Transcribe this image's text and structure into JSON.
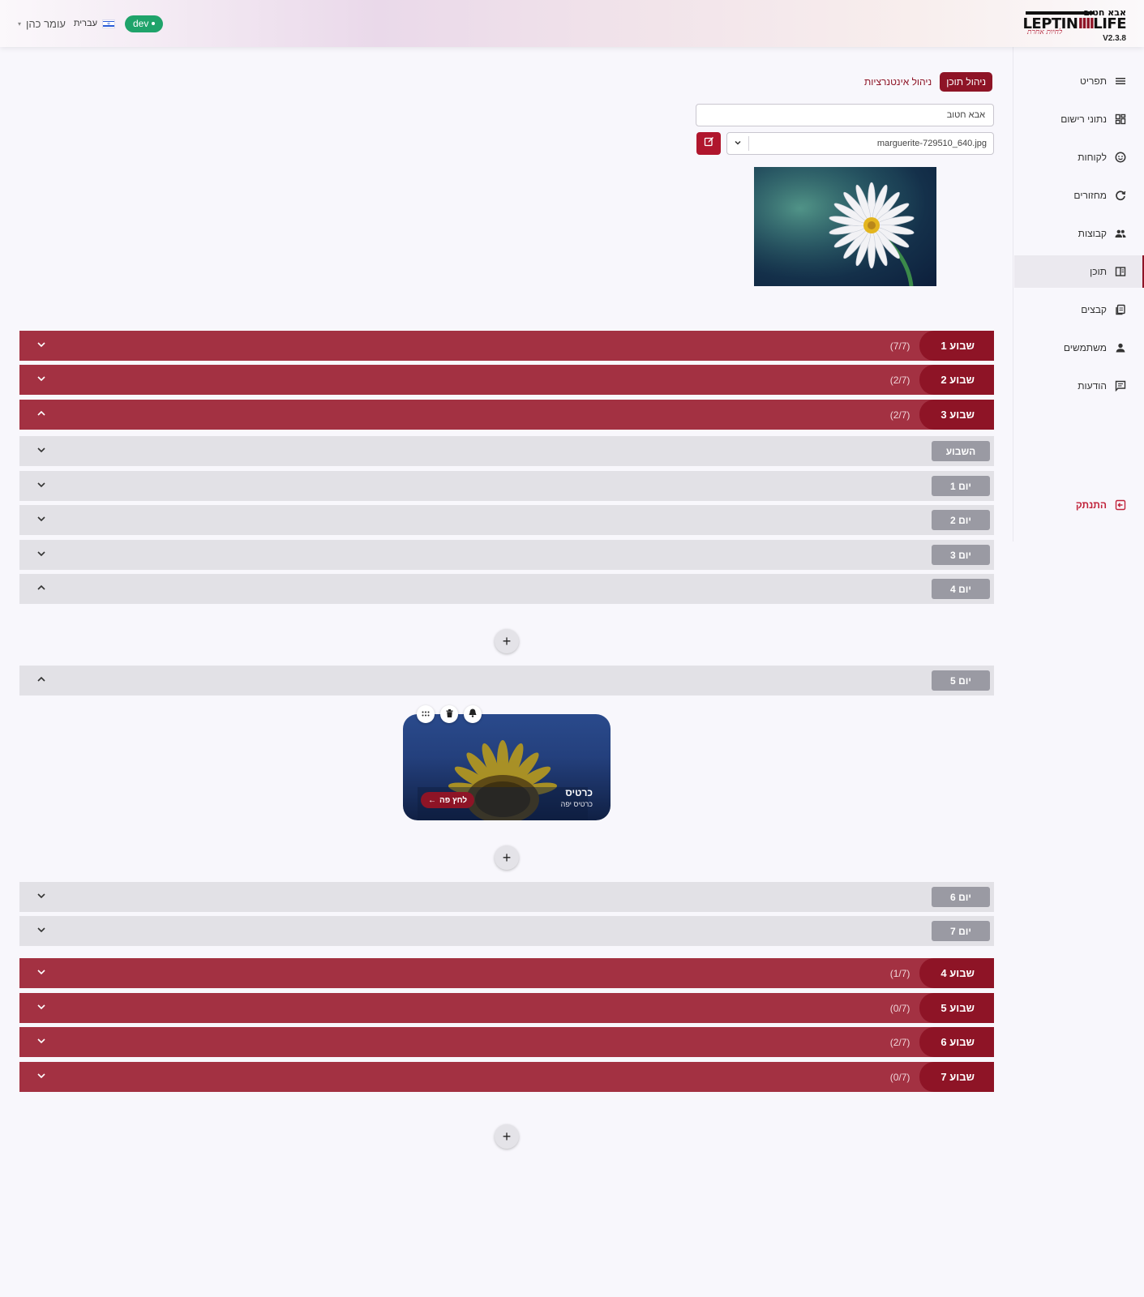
{
  "header": {
    "logo_top": "אבא חטוב",
    "logo_main_left": "LEPTIN",
    "logo_main_bars": "IIII",
    "logo_main_right": "LIFE",
    "logo_script": "לחיות אחרת",
    "version": "V2.3.8",
    "user_name": "עומר כהן",
    "language": "עברית",
    "env_badge": "dev"
  },
  "sidebar": {
    "items": [
      {
        "label": "תפריט",
        "icon": "menu-icon"
      },
      {
        "label": "נתוני רישום",
        "icon": "dashboard-icon"
      },
      {
        "label": "לקוחות",
        "icon": "face-icon"
      },
      {
        "label": "מחזורים",
        "icon": "cycle-icon"
      },
      {
        "label": "קבוצות",
        "icon": "group-icon"
      },
      {
        "label": "תוכן",
        "icon": "book-icon",
        "active": true
      },
      {
        "label": "קבצים",
        "icon": "files-icon"
      },
      {
        "label": "משתמשים",
        "icon": "person-icon"
      },
      {
        "label": "הודעות",
        "icon": "chat-icon"
      }
    ],
    "logout": "התנתק"
  },
  "tabs": {
    "active": "ניהול תוכן",
    "other": "ניהול אינטנרציות"
  },
  "form": {
    "name_value": "אבא חטוב",
    "file_value": "marguerite-729510_640.jpg"
  },
  "weeks_top": [
    {
      "label": "שבוע 1",
      "count": "(7/7)",
      "open": false
    },
    {
      "label": "שבוע 2",
      "count": "(2/7)",
      "open": false
    },
    {
      "label": "שבוע 3",
      "count": "(2/7)",
      "open": true
    }
  ],
  "days_a": [
    {
      "label": "השבוע",
      "open": false
    },
    {
      "label": "יום 1",
      "open": false
    },
    {
      "label": "יום 2",
      "open": false
    },
    {
      "label": "יום 3",
      "open": false
    },
    {
      "label": "יום 4",
      "open": true
    }
  ],
  "day5": {
    "label": "יום 5",
    "open": true
  },
  "days_b": [
    {
      "label": "יום 6",
      "open": false
    },
    {
      "label": "יום 7",
      "open": false
    }
  ],
  "weeks_bottom": [
    {
      "label": "שבוע 4",
      "count": "(1/7)",
      "open": false
    },
    {
      "label": "שבוע 5",
      "count": "(0/7)",
      "open": false
    },
    {
      "label": "שבוע 6",
      "count": "(2/7)",
      "open": false
    },
    {
      "label": "שבוע 7",
      "count": "(0/7)",
      "open": false
    }
  ],
  "card": {
    "title": "כרטיס",
    "subtitle": "כרטיס יפה",
    "button": "לחץ פה",
    "actions": [
      "drag-icon",
      "trash-icon",
      "bell-icon"
    ]
  },
  "colors": {
    "brand": "#8e1426",
    "week_row": "#a33142",
    "day_row": "#e2e1e6",
    "day_badge": "#9a9aa3",
    "env_badge": "#1fa36a"
  }
}
